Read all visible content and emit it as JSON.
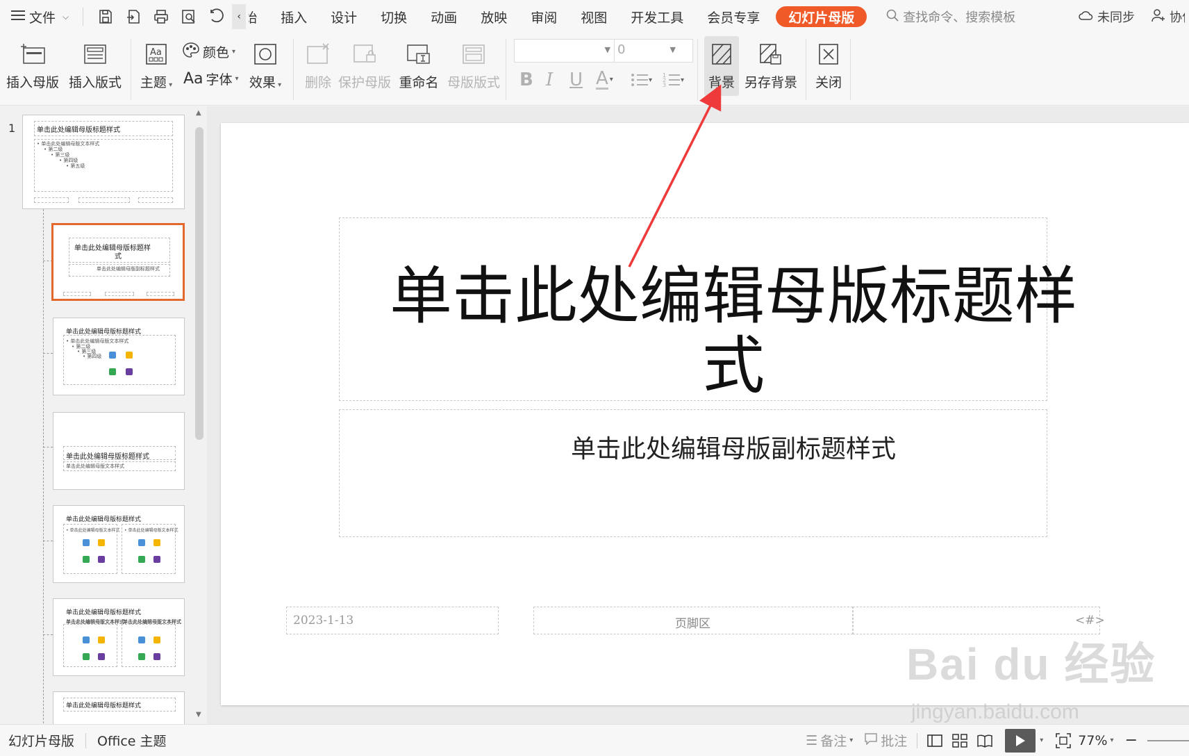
{
  "menubar": {
    "file_label": "文件",
    "tabs": [
      "开始",
      "插入",
      "设计",
      "切换",
      "动画",
      "放映",
      "审阅",
      "视图",
      "开发工具",
      "会员专享"
    ],
    "active_tab": "幻灯片母版",
    "search_placeholder": "查找命令、搜索模板",
    "sync_label": "未同步",
    "collab_label": "协作"
  },
  "ribbon": {
    "insert_master": "插入母版",
    "insert_layout": "插入版式",
    "theme": "主题",
    "colors": "颜色",
    "fonts_prefix": "Aa",
    "fonts": "字体",
    "effects": "效果",
    "delete": "删除",
    "protect_master": "保护母版",
    "rename": "重命名",
    "master_layout": "母版版式",
    "font_size_value": "0",
    "background": "背景",
    "save_background": "另存背景",
    "close": "关闭",
    "bold_glyph": "B",
    "italic_glyph": "I",
    "underline_glyph": "U",
    "fontcolor_glyph": "A"
  },
  "thumbnails": {
    "slide_number": "1",
    "master_title": "单击此处编辑母版标题样式",
    "master_body": "• 单击此处编辑母版文本样式",
    "level2": "• 第二级",
    "level3": "• 第三级",
    "level4": "• 第四级",
    "level5": "• 第五级",
    "layout_title_1": "单击此处编辑母版标题样",
    "layout_title_1b": "式",
    "layout_sub_1": "单击此处编辑母版副标题样式",
    "layout_title": "单击此处编辑母版标题样式",
    "layout_body": "• 单击此处编辑母版文本样式",
    "layout_body_2": "单击此处编辑母版文本样式"
  },
  "slide": {
    "title_line1": "单击此处编辑母版标题样",
    "title_line2": "式",
    "subtitle": "单击此处编辑母版副标题样式",
    "footer_date": "2023-1-13",
    "footer_center": "页脚区",
    "footer_page": "<#>"
  },
  "watermark": {
    "brand": "Bai du 经验",
    "url": "jingyan.baidu.com"
  },
  "statusbar": {
    "mode": "幻灯片母版",
    "theme": "Office 主题",
    "notes": "备注",
    "comments": "批注",
    "zoom": "77%"
  },
  "colors": {
    "accent": "#f05a28",
    "selected_thumb_border": "#e2692b",
    "arrow": "#ee3a3a"
  }
}
